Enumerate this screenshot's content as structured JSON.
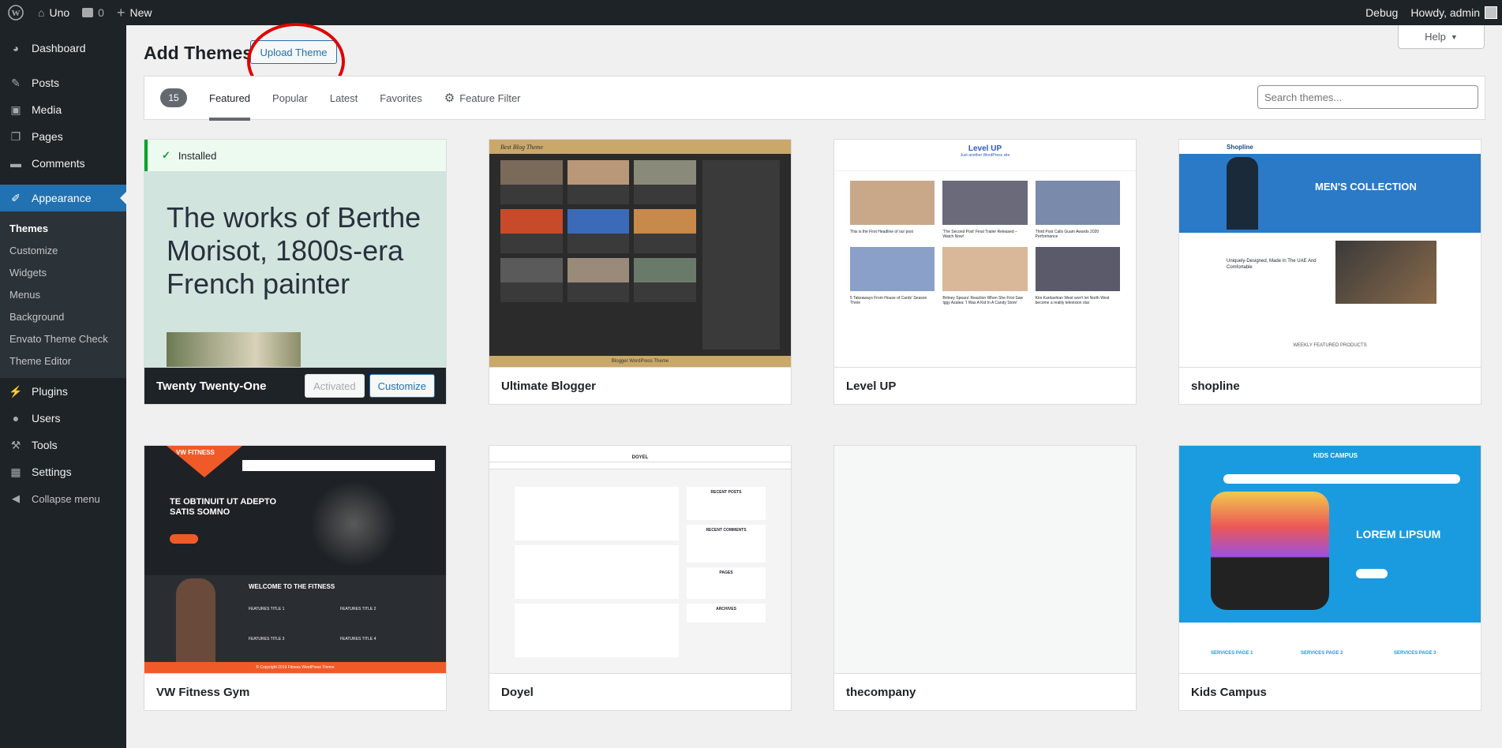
{
  "admin_bar": {
    "site_name": "Uno",
    "comments_count": "0",
    "new_label": "New",
    "debug_label": "Debug",
    "howdy_label": "Howdy, admin"
  },
  "sidebar": {
    "items": [
      {
        "label": "Dashboard",
        "icon": "dashboard-icon"
      },
      {
        "label": "Posts",
        "icon": "pin-icon"
      },
      {
        "label": "Media",
        "icon": "media-icon"
      },
      {
        "label": "Pages",
        "icon": "pages-icon"
      },
      {
        "label": "Comments",
        "icon": "comments-icon"
      },
      {
        "label": "Appearance",
        "icon": "brush-icon"
      }
    ],
    "submenu": [
      "Themes",
      "Customize",
      "Widgets",
      "Menus",
      "Background",
      "Envato Theme Check",
      "Theme Editor"
    ],
    "items2": [
      {
        "label": "Plugins",
        "icon": "plugin-icon"
      },
      {
        "label": "Users",
        "icon": "users-icon"
      },
      {
        "label": "Tools",
        "icon": "wrench-icon"
      },
      {
        "label": "Settings",
        "icon": "settings-icon"
      },
      {
        "label": "Collapse menu",
        "icon": "collapse-icon"
      }
    ]
  },
  "help_label": "Help",
  "page_title": "Add Themes",
  "upload_label": "Upload Theme",
  "filter": {
    "count": "15",
    "tabs": [
      "Featured",
      "Popular",
      "Latest",
      "Favorites"
    ],
    "feature_filter": "Feature Filter",
    "search_placeholder": "Search themes..."
  },
  "installed_label": "Installed",
  "featured_text": "The works of Berthe Morisot, 1800s-era French painter",
  "activated_label": "Activated",
  "customize_label": "Customize",
  "themes": [
    "Twenty Twenty-One",
    "Ultimate Blogger",
    "Level UP",
    "shopline",
    "VW Fitness Gym",
    "Doyel",
    "thecompany",
    "Kids Campus"
  ],
  "previews": {
    "blog_title": "Best Blog Theme",
    "blog_footer": "Blogger WordPress Theme",
    "levelup_title": "Level UP",
    "levelup_tagline": "Just another WordPress site",
    "levelup_posts": [
      "This is the First Headline of our post",
      "'The Second Post' Final Trailer Released – Watch Now!",
      "Third Post Calls Guam Awards 2020 Performance",
      "5 Takeaways From House of Cards' Season Three",
      "Britney Spears' Reaction When She First Saw Iggy Azalea: 'I Was A Kid In A Candy Store'",
      "Kim Kardashian West won't let North West become a reality television star"
    ],
    "shop_logo": "Shopline",
    "shop_banner": "MEN'S COLLECTION",
    "shop_sub": "Uniquely-Designed, Made In The UAE And Comfortable",
    "shop_products": "WEEKLY FEATURED PRODUCTS",
    "vw_logo": "VW FITNESS",
    "vw_heading": "TE OBTINUIT UT ADEPTO SATIS SOMNO",
    "vw_welcome": "WELCOME TO THE FITNESS",
    "vw_features": [
      "FEATURES TITLE 1",
      "FEATURES TITLE 2",
      "FEATURES TITLE 3",
      "FEATURES TITLE 4"
    ],
    "vw_footer": "© Copyright 2019 Fitness WordPress Theme",
    "doyel_title": "DOYEL",
    "doyel_widgets": [
      "RECENT POSTS",
      "RECENT COMMENTS",
      "PAGES",
      "ARCHIVES"
    ],
    "kids_title": "KIDS CAMPUS",
    "kids_banner": "LOREM LIPSUM",
    "kids_services": [
      "SERVICES PAGE 1",
      "SERVICES PAGE 2",
      "SERVICES PAGE 3"
    ]
  },
  "colors": {
    "admin_bg": "#1d2327",
    "accent": "#2271b1",
    "highlight_circle": "#e00000",
    "installed_green": "#00a32a"
  }
}
